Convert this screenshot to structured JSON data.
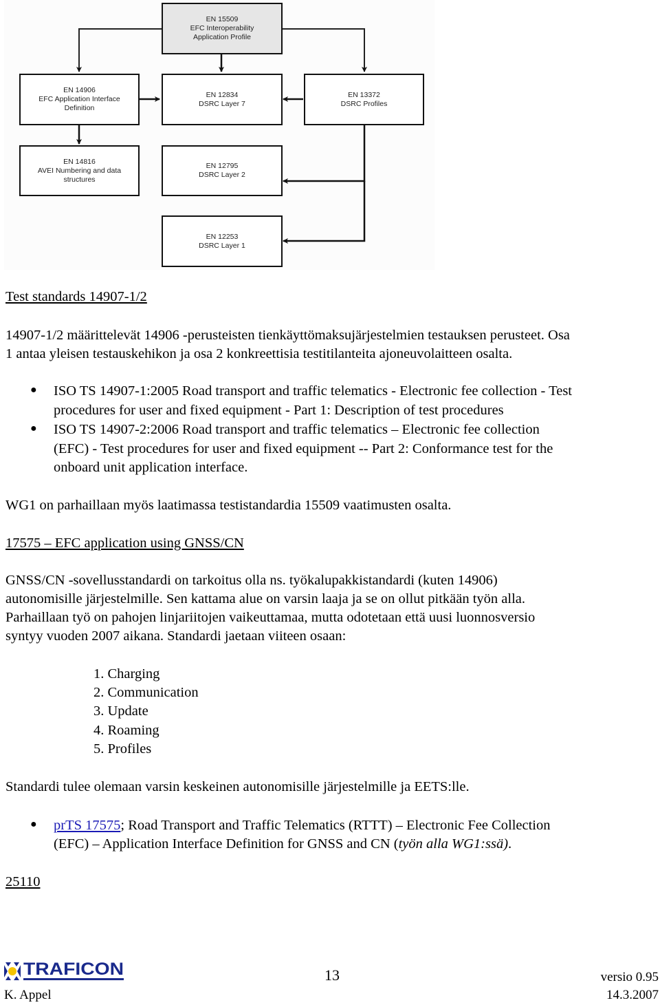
{
  "diagram": {
    "boxes": [
      {
        "id": "en15509",
        "code": "EN 15509",
        "lines": [
          "EFC Interoperability",
          "Application Profile"
        ]
      },
      {
        "id": "en14906",
        "code": "EN 14906",
        "lines": [
          "EFC Application Interface",
          "Definition"
        ]
      },
      {
        "id": "en12834",
        "code": "EN 12834",
        "lines": [
          "DSRC Layer 7"
        ]
      },
      {
        "id": "en13372",
        "code": "EN 13372",
        "lines": [
          "DSRC Profiles"
        ]
      },
      {
        "id": "en14816",
        "code": "EN 14816",
        "lines": [
          "AVEI Numbering and data",
          "structures"
        ]
      },
      {
        "id": "en12795",
        "code": "EN 12795",
        "lines": [
          "DSRC Layer 2"
        ]
      },
      {
        "id": "en12253",
        "code": "EN 12253",
        "lines": [
          "DSRC Layer 1"
        ]
      }
    ],
    "connections": [
      {
        "from": "EN 15509",
        "to": "EN 14906"
      },
      {
        "from": "EN 15509",
        "to": "EN 12834"
      },
      {
        "from": "EN 15509",
        "to": "EN 13372"
      },
      {
        "from": "EN 14906",
        "to": "EN 12834"
      },
      {
        "from": "EN 13372",
        "to": "EN 12834"
      },
      {
        "from": "EN 14906",
        "to": "EN 14816"
      },
      {
        "from": "EN 13372",
        "to": "EN 12795"
      },
      {
        "from": "EN 13372",
        "to": "EN 12253"
      }
    ]
  },
  "section1": {
    "heading": "Test standards 14907-1/2",
    "para_lines": [
      "14907-1/2 määrittelevät 14906 -perusteisten tienkäyttömaksujärjestelmien testauksen perusteet. Osa",
      "1 antaa yleisen testauskehikon ja osa 2 konkreettisia testitilanteita ajoneuvolaitteen osalta."
    ],
    "bullets": [
      {
        "lines": [
          "ISO TS 14907-1:2005 Road transport and traffic telematics - Electronic fee collection - Test",
          "procedures for user and fixed equipment - Part 1: Description of test procedures"
        ]
      },
      {
        "lines": [
          "ISO TS 14907-2:2006 Road transport and traffic telematics – Electronic fee collection",
          "(EFC) - Test procedures for user and fixed equipment -- Part 2: Conformance test for the",
          "onboard unit application interface."
        ]
      }
    ],
    "wg1_note": "WG1 on parhaillaan myös laatimassa testistandardia 15509 vaatimusten osalta."
  },
  "section2": {
    "heading": "17575 – EFC application using GNSS/CN",
    "para_lines": [
      "GNSS/CN -sovellusstandardi on tarkoitus olla ns. työkalupakkistandardi (kuten 14906)",
      "autonomisille järjestelmille. Sen kattama alue on varsin laaja ja se on ollut pitkään työn alla.",
      "Parhaillaan työ on pahojen linjariitojen vaikeuttamaa, mutta odotetaan että uusi luonnosversio",
      "syntyy vuoden 2007 aikana. Standardi jaetaan viiteen osaan:"
    ],
    "parts": [
      "1. Charging",
      "2. Communication",
      "3. Update",
      "4. Roaming",
      "5. Profiles"
    ],
    "summary": "Standardi tulee olemaan varsin keskeinen autonomisille järjestelmille ja EETS:lle.",
    "bullet": {
      "link_text": "prTS 17575",
      "line1_rest": "; Road Transport and Traffic Telematics (RTTT) – Electronic Fee Collection",
      "line2_main": "(EFC) – Application Interface Definition for GNSS and CN (",
      "line2_italic": "työn alla WG1:ssä)",
      "line2_end": "."
    }
  },
  "section3": {
    "heading": "25110"
  },
  "footer": {
    "logo_text": "TRAFICON",
    "page_number": "13",
    "version": "versio 0.95",
    "author": "K. Appel",
    "date": "14.3.2007"
  },
  "colors": {
    "link": "#1a1ab5",
    "logo_blue": "#1a2a8c",
    "logo_yellow": "#f5c400"
  }
}
